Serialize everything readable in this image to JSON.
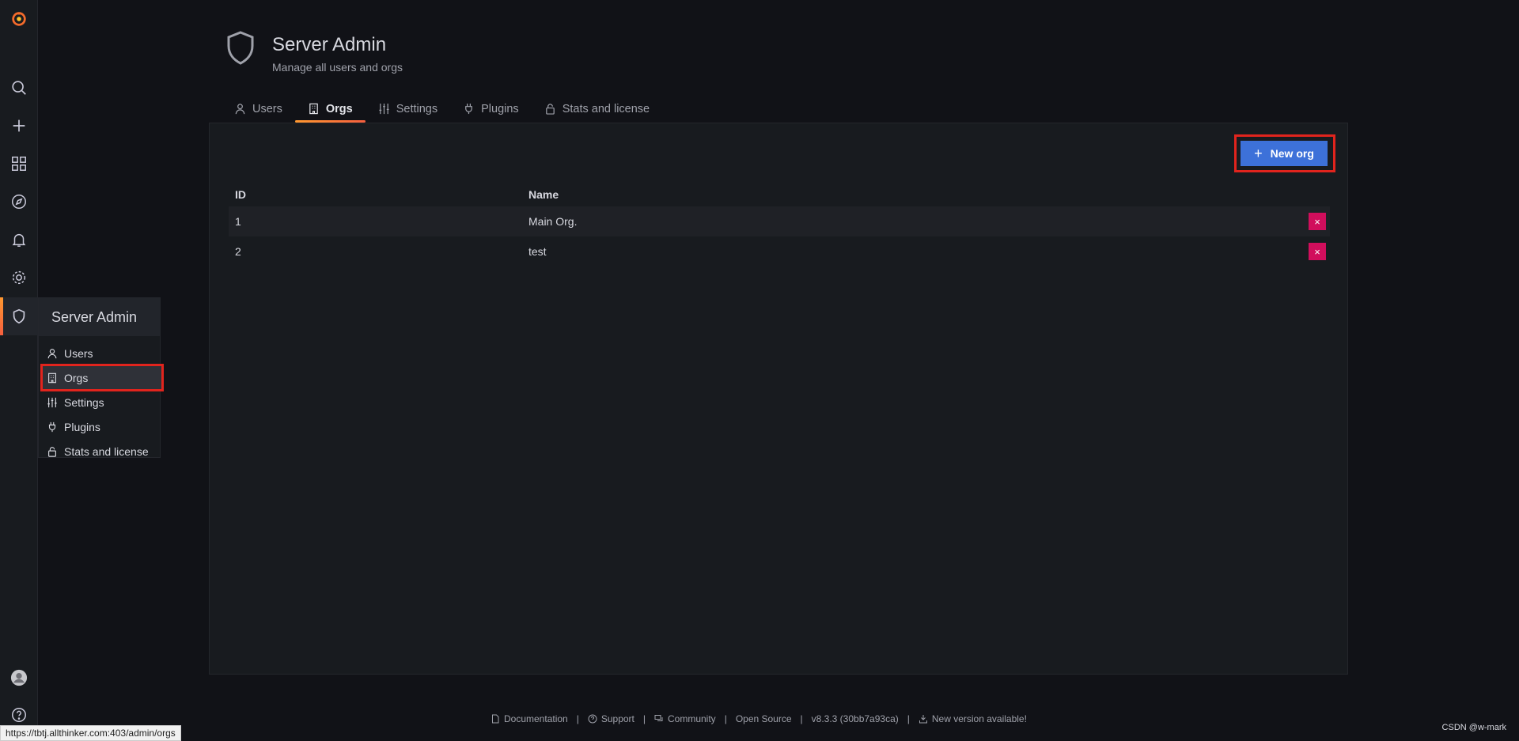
{
  "sidebar": {
    "icons": [
      "grafana-logo-icon",
      "search-icon",
      "plus-icon",
      "dashboards-icon",
      "explore-icon",
      "alerting-icon",
      "configuration-icon",
      "shield-icon",
      "user-avatar-icon",
      "help-icon"
    ]
  },
  "flyout": {
    "title": "Server Admin",
    "items": [
      {
        "label": "Users",
        "icon": "user-icon"
      },
      {
        "label": "Orgs",
        "icon": "building-icon"
      },
      {
        "label": "Settings",
        "icon": "sliders-icon"
      },
      {
        "label": "Plugins",
        "icon": "plug-icon"
      },
      {
        "label": "Stats and license",
        "icon": "lock-icon"
      }
    ]
  },
  "header": {
    "title": "Server Admin",
    "subtitle": "Manage all users and orgs"
  },
  "tabs": [
    {
      "label": "Users",
      "icon": "user-icon"
    },
    {
      "label": "Orgs",
      "icon": "building-icon",
      "active": true
    },
    {
      "label": "Settings",
      "icon": "sliders-icon"
    },
    {
      "label": "Plugins",
      "icon": "plug-icon"
    },
    {
      "label": "Stats and license",
      "icon": "lock-icon"
    }
  ],
  "new_org_button": "New org",
  "table": {
    "columns": [
      "ID",
      "Name"
    ],
    "rows": [
      {
        "id": "1",
        "name": "Main Org."
      },
      {
        "id": "2",
        "name": "test"
      }
    ],
    "delete_label": "×"
  },
  "footer": {
    "documentation": "Documentation",
    "support": "Support",
    "community": "Community",
    "open_source": "Open Source",
    "version": "v8.3.3 (30bb7a93ca)",
    "new_version": "New version available!",
    "separator": "|"
  },
  "status_url": "https://tbtj.allthinker.com:403/admin/orgs",
  "watermark": "CSDN @w-mark",
  "colors": {
    "accent": "#f55f3e",
    "primary_button": "#3d71d9",
    "danger": "#d10e5c",
    "highlight_box": "#e1241d"
  }
}
